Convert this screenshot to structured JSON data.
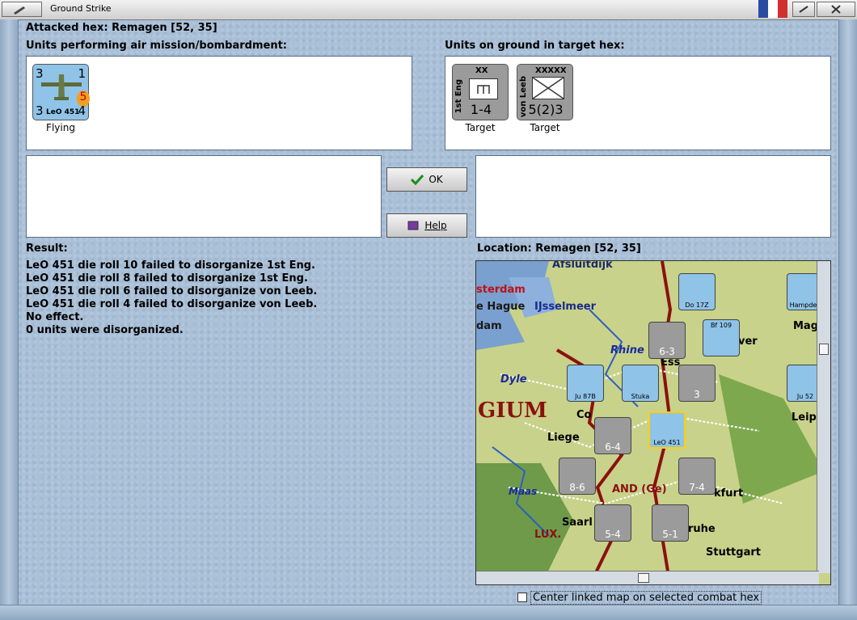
{
  "window": {
    "title": "Ground Strike"
  },
  "header": {
    "attacked_hex": "Attacked hex: Remagen  [52, 35]"
  },
  "air_panel": {
    "label": "Units performing air mission/bombardment:",
    "units": [
      {
        "name": "LeO 451",
        "tl": "3",
        "tr": "1",
        "bl": "3",
        "br": "4",
        "badge": "5",
        "status": "Flying"
      }
    ]
  },
  "ground_panel": {
    "label": "Units on ground in target hex:",
    "units": [
      {
        "size": "XX",
        "name": "1st Eng",
        "strength": "1-4",
        "status": "Target"
      },
      {
        "size": "XXXXX",
        "name": "von Leeb",
        "strength": "5(2)3",
        "status": "Target"
      }
    ]
  },
  "buttons": {
    "ok": "OK",
    "help": "Help"
  },
  "result": {
    "label": "Result:",
    "lines": [
      "LeO 451 die roll 10 failed to disorganize 1st Eng.",
      "LeO 451 die roll 8 failed to disorganize 1st Eng.",
      "LeO 451 die roll 6 failed to disorganize von Leeb.",
      "LeO 451 die roll 4 failed to disorganize von Leeb.",
      "No effect.",
      "0 units were disorganized."
    ]
  },
  "location": {
    "label": "Location:  Remagen  [52, 35]"
  },
  "map": {
    "places": [
      "Afsluitdijk",
      "sterdam",
      "e Hague",
      "IJsselmeer",
      "dam",
      "Rhine",
      "Dyle",
      "GIUM",
      "Liege",
      "Maas",
      "AND (Ge)",
      "Saarl",
      "LUX.",
      "Magd",
      "Leip",
      "kfurt",
      "ruhe",
      "Stuttgart",
      "Ess",
      "Co",
      "ver"
    ],
    "units": [
      {
        "v": "6-3"
      },
      {
        "v": "6-4"
      },
      {
        "v": "8-6"
      },
      {
        "v": "7-4"
      },
      {
        "v": "5-4"
      },
      {
        "v": "5-1"
      },
      {
        "v": "3"
      }
    ],
    "air_units": [
      "Do 17Z",
      "Bf 109",
      "Ju 87B",
      "Stuka",
      "LeO 451",
      "Hampden",
      "Ju 52"
    ]
  },
  "checkbox": {
    "label": "Center linked map on selected combat hex",
    "checked": false
  },
  "colors": {
    "background": "#a9c0d8",
    "flag_blue": "#2a4ca0",
    "flag_red": "#d03030"
  }
}
